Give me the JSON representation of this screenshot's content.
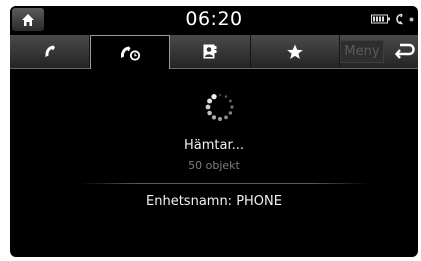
{
  "status": {
    "time": "06:20",
    "icons": [
      "home-icon",
      "battery-icon",
      "phone-signal-icon",
      "dot-indicator-icon"
    ]
  },
  "tabs": [
    {
      "name": "call-history",
      "icon": "handset-icon",
      "active": false
    },
    {
      "name": "recent-calls",
      "icon": "handset-clock-icon",
      "active": true
    },
    {
      "name": "contacts",
      "icon": "contacts-book-icon",
      "active": false
    },
    {
      "name": "favorites",
      "icon": "star-icon",
      "active": false
    }
  ],
  "toolbar": {
    "menu_label": "Meny",
    "menu_enabled": false
  },
  "content": {
    "loading_label": "Hämtar...",
    "count_label": "50 objekt",
    "device_label": "Enhetsnamn: PHONE"
  },
  "colors": {
    "background": "#000000",
    "tabbar": "#3a3a3a",
    "text": "#f2f2f2",
    "muted": "#7d7d7d"
  }
}
